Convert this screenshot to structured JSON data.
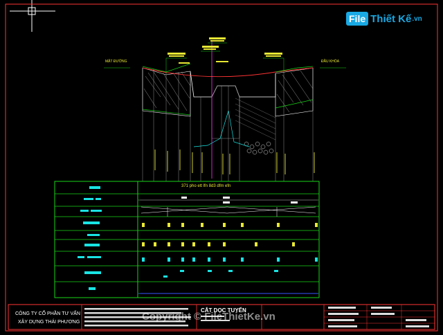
{
  "logo": {
    "brand_box": "File",
    "brand_text": "Thiết Kế",
    "brand_suffix": ".vn"
  },
  "profile": {
    "left_label": "MẶT ĐƯỜNG",
    "right_label": "ĐẦU KHÓA",
    "table_row_1": "371 pho ett lfn 8d3 dfm efn"
  },
  "title_block": {
    "company_line_1": "CÔNG TY CỔ PHẦN TƯ VẤN",
    "company_line_2": "XÂY DỰNG THÁI PHƯƠNG",
    "drawing_title": "CẮT DỌC TUYẾN"
  },
  "watermark": {
    "text": "Copyright © FileThietKe.vn"
  },
  "colors": {
    "background": "#000000",
    "grid_green": "#19d619",
    "accent_cyan": "#19e4e4",
    "profile_red": "#ff3333",
    "label_yellow": "#e8e833",
    "frame_white": "#ffffff"
  }
}
